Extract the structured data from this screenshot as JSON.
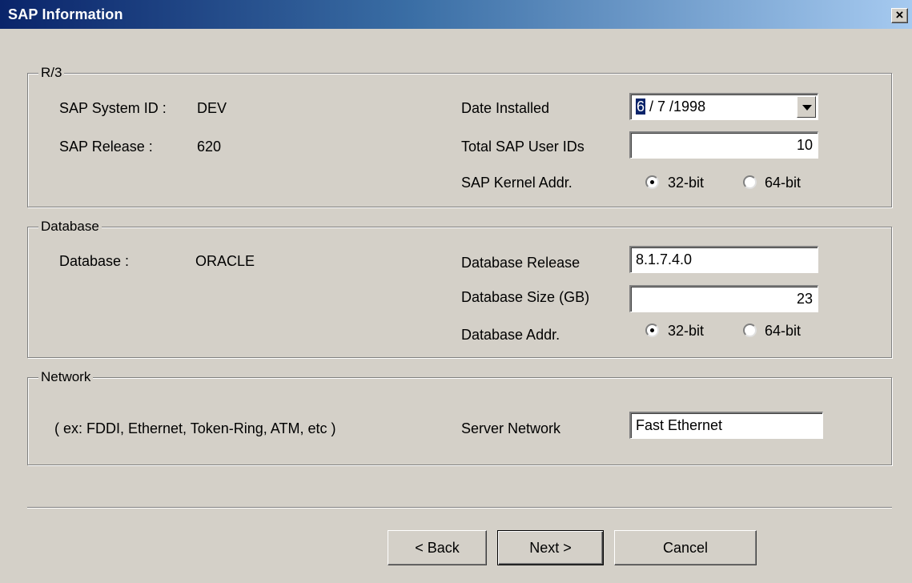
{
  "window": {
    "title": "SAP Information",
    "close_glyph": "×"
  },
  "r3": {
    "legend": "R/3",
    "system_id_label": "SAP System ID :",
    "system_id_value": "DEV",
    "release_label": "SAP Release :",
    "release_value": "620",
    "date_installed_label": "Date Installed",
    "date_installed": {
      "month": "6",
      "rest": " / 7 /1998"
    },
    "total_user_ids_label": "Total SAP User IDs",
    "total_user_ids": "10",
    "kernel_addr_label": "SAP Kernel Addr.",
    "kernel_addr_options": [
      "32-bit",
      "64-bit"
    ],
    "kernel_addr_selected": "32-bit"
  },
  "database": {
    "legend": "Database",
    "db_label": "Database :",
    "db_value": "ORACLE",
    "release_label": "Database Release",
    "release_value": "8.1.7.4.0",
    "size_label": "Database Size  (GB)",
    "size_value": "23",
    "addr_label": "Database Addr.",
    "addr_options": [
      "32-bit",
      "64-bit"
    ],
    "addr_selected": "32-bit"
  },
  "network": {
    "legend": "Network",
    "hint": "( ex:  FDDI, Ethernet, Token-Ring, ATM, etc )",
    "server_network_label": "Server Network",
    "server_network_value": "Fast Ethernet"
  },
  "buttons": {
    "back": "< Back",
    "next": "Next >",
    "cancel": "Cancel"
  }
}
